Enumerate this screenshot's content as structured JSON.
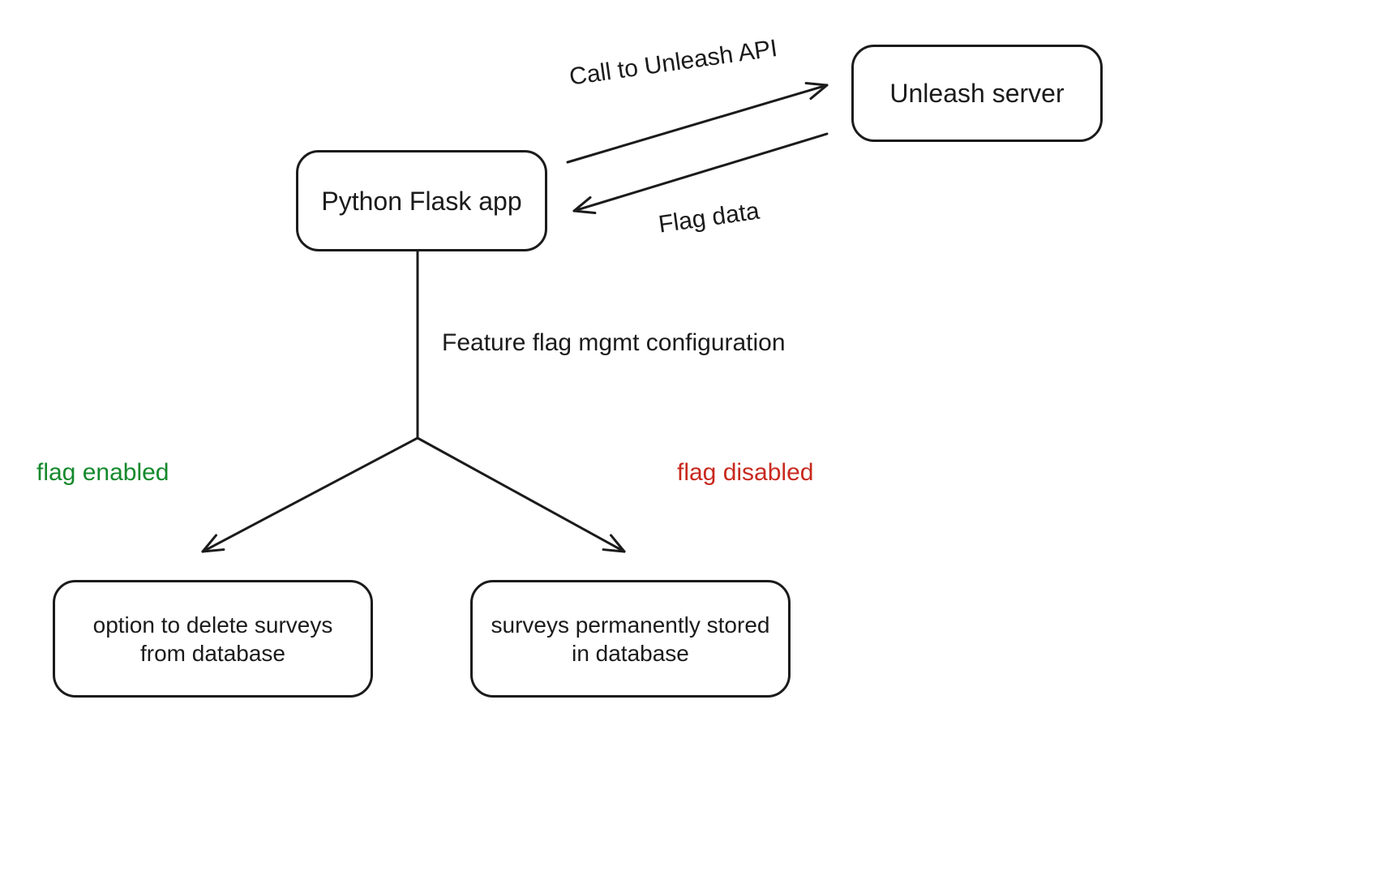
{
  "nodes": {
    "flask_app": "Python Flask app",
    "unleash_server": "Unleash server",
    "enabled_outcome": "option to delete surveys from database",
    "disabled_outcome": "surveys permanently stored in database"
  },
  "labels": {
    "call_api": "Call to Unleash API",
    "flag_data": "Flag data",
    "config": "Feature flag mgmt configuration",
    "enabled": "flag enabled",
    "disabled": "flag disabled"
  },
  "colors": {
    "ink": "#1b1b1b",
    "green": "#14892c",
    "red": "#c8291e",
    "bg": "#ffffff"
  }
}
